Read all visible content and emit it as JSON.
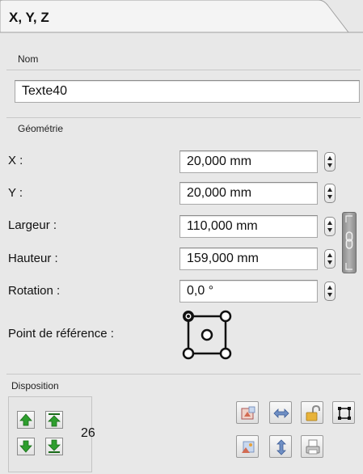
{
  "tab": {
    "title": "X, Y, Z"
  },
  "name_section": {
    "label": "Nom",
    "value": "Texte40"
  },
  "geometry": {
    "label": "Géométrie",
    "rows": [
      {
        "label": "X :",
        "value": "20,000 mm"
      },
      {
        "label": "Y :",
        "value": "20,000 mm"
      },
      {
        "label": "Largeur :",
        "value": "110,000 mm"
      },
      {
        "label": "Hauteur :",
        "value": "159,000 mm"
      },
      {
        "label": "Rotation :",
        "value": "0,0 °"
      }
    ],
    "reference_point_label": "Point de référence :"
  },
  "disposition": {
    "label": "Disposition",
    "level": "26"
  },
  "colors": {
    "accent_green": "#2e9e2e",
    "panel_bg": "#e8e8e8"
  }
}
